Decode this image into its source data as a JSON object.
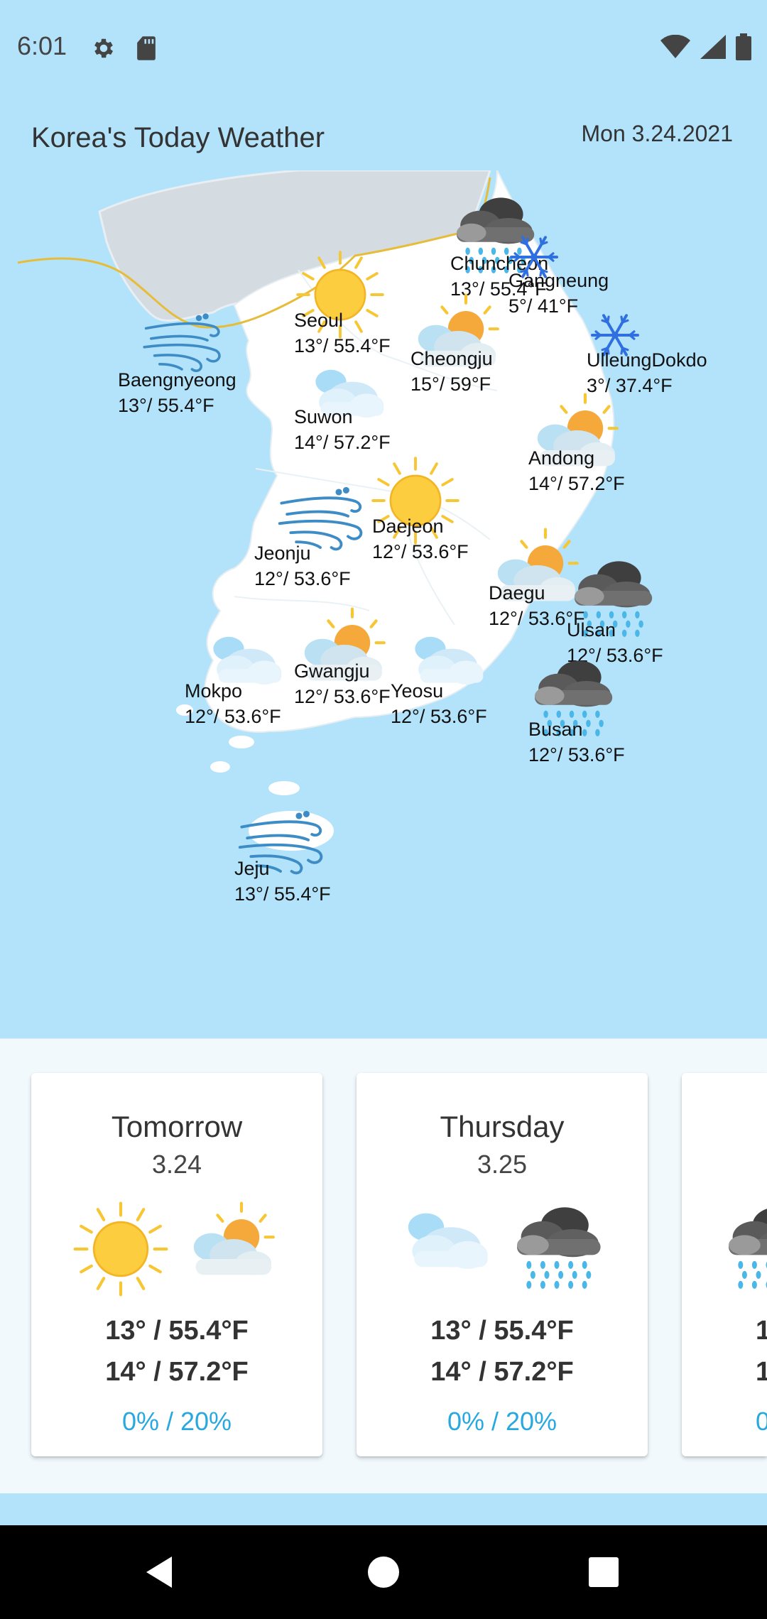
{
  "status": {
    "time": "6:01",
    "icons": [
      "gear-icon",
      "sd-card-icon",
      "wifi-icon",
      "signal-icon",
      "battery-icon"
    ]
  },
  "header": {
    "title": "Korea's Today Weather",
    "date": "Mon 3.24.2021"
  },
  "cities": [
    {
      "name": "Chuncheon",
      "temp": "13°/ 55.4°F",
      "icon": "rain-cloud"
    },
    {
      "name": "Gangneung",
      "temp": "5°/ 41°F",
      "icon": "snowflake"
    },
    {
      "name": "Seoul",
      "temp": "13°/ 55.4°F",
      "icon": "sun"
    },
    {
      "name": "Cheongju",
      "temp": "15°/ 59°F",
      "icon": "partly-cloudy"
    },
    {
      "name": "UlleungDokdo",
      "temp": "3°/ 37.4°F",
      "icon": "snowflake"
    },
    {
      "name": "Baengnyeong",
      "temp": "13°/ 55.4°F",
      "icon": "wind"
    },
    {
      "name": "Suwon",
      "temp": "14°/ 57.2°F",
      "icon": "cloudy"
    },
    {
      "name": "Andong",
      "temp": "14°/ 57.2°F",
      "icon": "partly-cloudy"
    },
    {
      "name": "Daejeon",
      "temp": "12°/ 53.6°F",
      "icon": "sun"
    },
    {
      "name": "Jeonju",
      "temp": "12°/ 53.6°F",
      "icon": "wind"
    },
    {
      "name": "Daegu",
      "temp": "12°/ 53.6°F",
      "icon": "partly-cloudy"
    },
    {
      "name": "Ulsan",
      "temp": "12°/ 53.6°F",
      "icon": "rain-cloud"
    },
    {
      "name": "Gwangju",
      "temp": "12°/ 53.6°F",
      "icon": "partly-cloudy"
    },
    {
      "name": "Mokpo",
      "temp": "12°/ 53.6°F",
      "icon": "cloudy"
    },
    {
      "name": "Yeosu",
      "temp": "12°/ 53.6°F",
      "icon": "cloudy"
    },
    {
      "name": "Busan",
      "temp": "12°/ 53.6°F",
      "icon": "rain-cloud"
    },
    {
      "name": "Jeju",
      "temp": "13°/ 55.4°F",
      "icon": "wind"
    }
  ],
  "forecast": [
    {
      "day": "Tomorrow",
      "date": "3.24",
      "icon_am": "sun",
      "icon_pm": "partly-cloudy",
      "hi": "13° / 55.4°F",
      "lo": "14° / 57.2°F",
      "rain": "0% / 20%"
    },
    {
      "day": "Thursday",
      "date": "3.25",
      "icon_am": "cloudy",
      "icon_pm": "rain-cloud",
      "hi": "13° / 55.4°F",
      "lo": "14° / 57.2°F",
      "rain": "0% / 20%"
    },
    {
      "day": "",
      "date": "",
      "icon_am": "rain-cloud",
      "icon_pm": "",
      "hi": "1",
      "lo": "1",
      "rain": "0"
    }
  ],
  "colors": {
    "sky": "#b3e3fa",
    "sea_land": "#ffffff",
    "north": "#d4dbe1",
    "border": "#e4b52d",
    "rain_text": "#29a8e0"
  }
}
